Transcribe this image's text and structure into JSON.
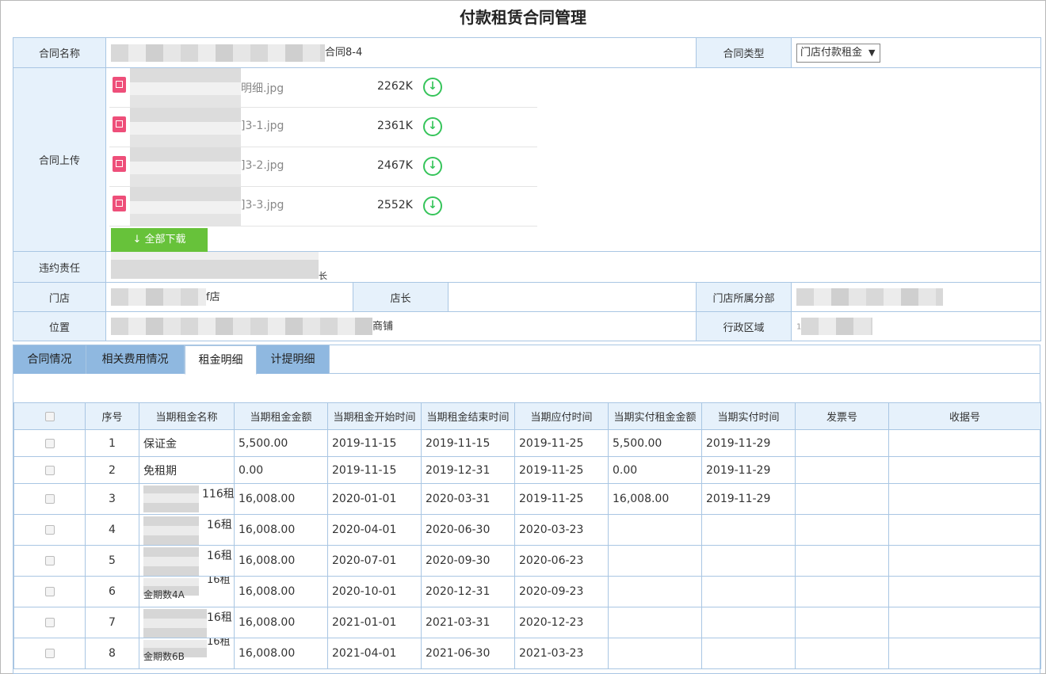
{
  "page": {
    "title": "付款租赁合同管理"
  },
  "form": {
    "contract_name_label": "合同名称",
    "contract_name_visible": "合同8-4",
    "contract_type_label": "合同类型",
    "contract_type_value": "门店付款租金",
    "upload_label": "合同上传",
    "files": [
      {
        "name_suffix": "明细.jpg",
        "size": "2262K"
      },
      {
        "name_suffix": "]3-1.jpg",
        "size": "2361K"
      },
      {
        "name_suffix": "]3-2.jpg",
        "size": "2467K"
      },
      {
        "name_suffix": "]3-3.jpg",
        "size": "2552K"
      }
    ],
    "download_all_label": "全部下载",
    "download_icon": "arrow-down-circle-icon",
    "breach_label": "违约责任",
    "breach_visible": "长",
    "store_label": "门店",
    "store_visible": "f店",
    "manager_label": "店长",
    "manager_value": "",
    "branch_label": "门店所属分部",
    "location_label": "位置",
    "location_visible": "商铺",
    "district_label": "行政区域",
    "district_visible": "1"
  },
  "tabs": [
    {
      "label": "合同情况"
    },
    {
      "label": "相关费用情况"
    },
    {
      "label": "租金明细"
    },
    {
      "label": "计提明细"
    }
  ],
  "grid": {
    "headers": [
      "",
      "序号",
      "当期租金名称",
      "当期租金金额",
      "当期租金开始时间",
      "当期租金结束时间",
      "当期应付时间",
      "当期实付租金金额",
      "当期实付时间",
      "发票号",
      "收据号"
    ],
    "rows": [
      {
        "no": "1",
        "name": "保证金",
        "amount": "5,500.00",
        "start": "2019-11-15",
        "end": "2019-11-15",
        "due": "2019-11-25",
        "paid": "5,500.00",
        "paid_date": "2019-11-29",
        "invoice": "",
        "receipt": ""
      },
      {
        "no": "2",
        "name": "免租期",
        "amount": "0.00",
        "start": "2019-11-15",
        "end": "2019-12-31",
        "due": "2019-11-25",
        "paid": "0.00",
        "paid_date": "2019-11-29",
        "invoice": "",
        "receipt": ""
      },
      {
        "no": "3",
        "name": "116租",
        "amount": "16,008.00",
        "start": "2020-01-01",
        "end": "2020-03-31",
        "due": "2019-11-25",
        "paid": "16,008.00",
        "paid_date": "2019-11-29",
        "invoice": "",
        "receipt": ""
      },
      {
        "no": "4",
        "name": "16租",
        "amount": "16,008.00",
        "start": "2020-04-01",
        "end": "2020-06-30",
        "due": "2020-03-23",
        "paid": "",
        "paid_date": "",
        "invoice": "",
        "receipt": ""
      },
      {
        "no": "5",
        "name": "16租",
        "amount": "16,008.00",
        "start": "2020-07-01",
        "end": "2020-09-30",
        "due": "2020-06-23",
        "paid": "",
        "paid_date": "",
        "invoice": "",
        "receipt": ""
      },
      {
        "no": "6",
        "name": "16租",
        "name2": "金期数4A",
        "amount": "16,008.00",
        "start": "2020-10-01",
        "end": "2020-12-31",
        "due": "2020-09-23",
        "paid": "",
        "paid_date": "",
        "invoice": "",
        "receipt": ""
      },
      {
        "no": "7",
        "name": "16租",
        "amount": "16,008.00",
        "start": "2021-01-01",
        "end": "2021-03-31",
        "due": "2020-12-23",
        "paid": "",
        "paid_date": "",
        "invoice": "",
        "receipt": ""
      },
      {
        "no": "8",
        "name": "16租",
        "name2": "金期数6B",
        "amount": "16,008.00",
        "start": "2021-04-01",
        "end": "2021-06-30",
        "due": "2021-03-23",
        "paid": "",
        "paid_date": "",
        "invoice": "",
        "receipt": ""
      }
    ]
  }
}
